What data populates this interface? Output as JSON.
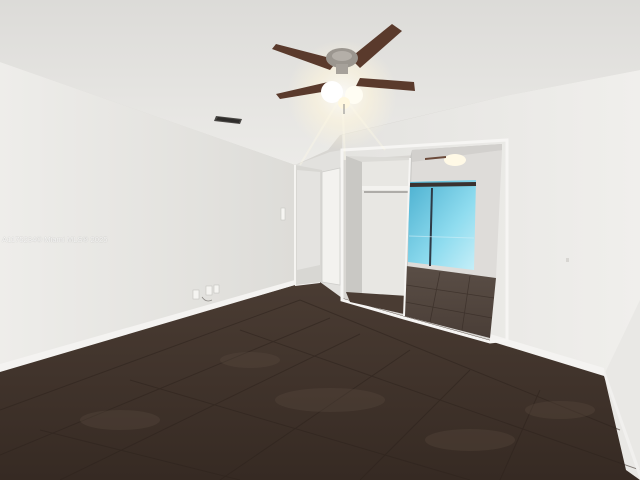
{
  "watermark": {
    "text": "A1175234© Miami MLS® 2025"
  },
  "colors": {
    "ceiling": "#e6e5e3",
    "left_wall": "#e8e7e4",
    "right_wall": "#efeeeb",
    "floor_tile": "#3e3129",
    "baseboard": "#f4f3f1",
    "fan_blade": "#5a3a2c",
    "mirror_tint": "#a8a6a4",
    "window_glow": "#7fd3e8"
  },
  "icons": {
    "ceiling_fan": "ceiling-fan-icon",
    "light_fixture": "light-fixture-icon",
    "air_vent": "air-vent-icon",
    "power_outlet": "power-outlet-icon",
    "light_switch": "light-switch-icon"
  }
}
